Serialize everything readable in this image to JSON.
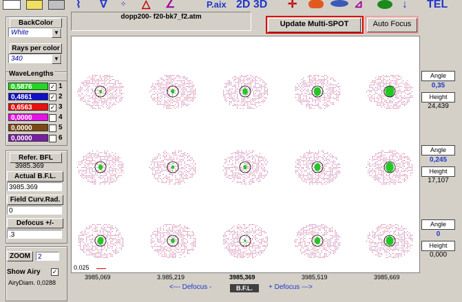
{
  "toolbar": {
    "labels": [
      "P.aix",
      "2D 3D",
      "TEL"
    ]
  },
  "left": {
    "backcolor_label": "BackColor",
    "backcolor_value": "White",
    "rays_label": "Rays per color",
    "rays_value": "340",
    "wavelengths_label": "WaveLengths",
    "wavelengths": [
      {
        "value": "0,5876",
        "color": "#22d822",
        "checked": true,
        "num": "1"
      },
      {
        "value": "0,4861",
        "color": "#1010c8",
        "checked": true,
        "num": "2"
      },
      {
        "value": "0,6563",
        "color": "#e81010",
        "checked": true,
        "num": "3"
      },
      {
        "value": "0,0000",
        "color": "#e810e8",
        "checked": false,
        "num": "4"
      },
      {
        "value": "0,0000",
        "color": "#7a4a14",
        "checked": false,
        "num": "5"
      },
      {
        "value": "0,0000",
        "color": "#7820a0",
        "checked": false,
        "num": "6"
      }
    ],
    "refer_bfl_label": "Refer.  BFL",
    "refer_bfl_value": "3985.369",
    "actual_bfl_label": "Actual  B.F.L.",
    "actual_bfl_value": "3985.369",
    "field_curv_label": "Field Curv.Rad.",
    "field_curv_value": "0",
    "defocus_label": "Defocus +/-",
    "defocus_value": ".3",
    "zoom_label": "ZOOM",
    "zoom_value": "2",
    "show_airy_label": "Show Airy",
    "airy_diam": "AiryDiam. 0,0288"
  },
  "title": "dopp200- f20-bk7_f2.atm",
  "update_button": "Update  Multi-SPOT",
  "autofocus_button": "Auto Focus",
  "scale_label": "0.025",
  "columns": [
    "3985,069",
    "3.985,219",
    "3985,369",
    "3985,519",
    "3985,669"
  ],
  "defocus_left": "<---  Defocus  -",
  "defocus_center": "B.F.L.",
  "defocus_right": "+ Defocus --->",
  "right": {
    "angle_label": "Angle",
    "height_label": "Height",
    "rows": [
      {
        "angle": "0,35",
        "height": "24,439"
      },
      {
        "angle": "0,245",
        "height": "17,107"
      },
      {
        "angle": "0",
        "height": "0,000"
      }
    ]
  },
  "spots": [
    [
      0.05,
      0.15,
      0.35,
      0.55,
      0.75
    ],
    [
      0.25,
      0.1,
      0.15,
      0.45,
      0.65
    ],
    [
      0.45,
      0.2,
      0.0,
      0.4,
      0.6
    ]
  ]
}
